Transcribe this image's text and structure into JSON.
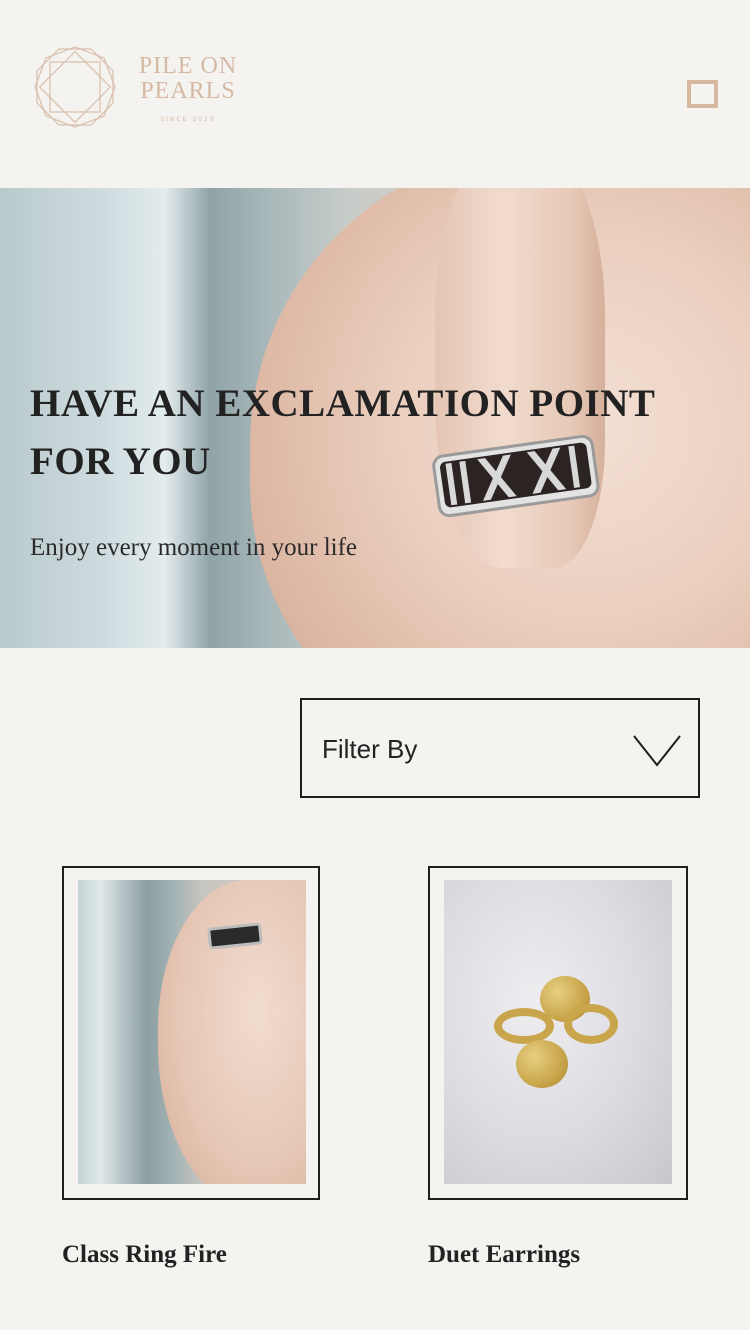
{
  "brand": {
    "name_line1": "PILE ON",
    "name_line2": "PEARLS",
    "since": "SINCE 2019",
    "color": "#d5b9a4"
  },
  "header": {
    "menu_icon": "menu-icon"
  },
  "hero": {
    "title": "HAVE AN EXCLAMATION POINT FOR YOU",
    "subtitle": "Enjoy every moment in your life"
  },
  "filter": {
    "label": "Filter By",
    "icon": "chevron-down-icon"
  },
  "products": [
    {
      "name": "Class Ring Fire"
    },
    {
      "name": "Duet Earrings"
    }
  ]
}
